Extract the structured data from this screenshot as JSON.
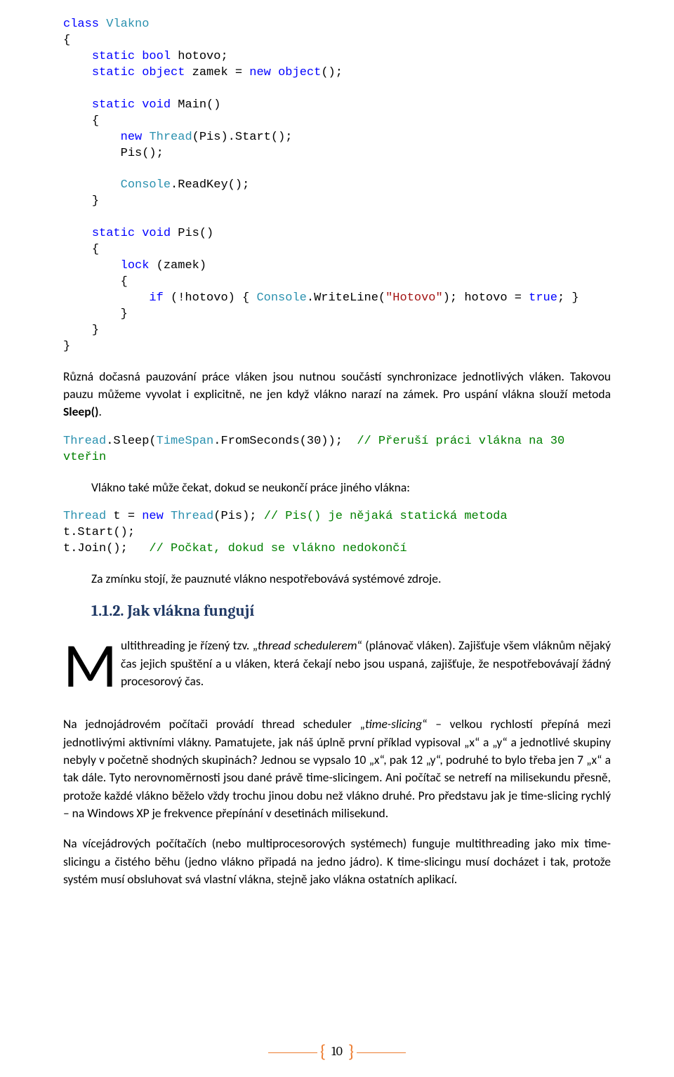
{
  "code1": {
    "kw_class": "class",
    "cls_Vlakno": "Vlakno",
    "lb1": "{",
    "indent": "    ",
    "kw_static": "static",
    "kw_bool": "bool",
    "id_hotovo": "hotovo;",
    "kw_object": "object",
    "id_zamek": "zamek = ",
    "kw_new": "new",
    "obj_ctor": "object",
    "obj_end": "();",
    "kw_void": "void",
    "id_main": "Main()",
    "lb2": "{",
    "newthread_new": "new",
    "newthread_cls": "Thread",
    "newthread_rest": "(Pis).Start();",
    "pis_call": "Pis();",
    "console_cls": "Console",
    "readkey": ".ReadKey();",
    "rb1": "}",
    "id_pis": "Pis()",
    "kw_lock": "lock",
    "lock_arg": " (zamek)",
    "kw_if": "if",
    "if_cond": " (!hotovo) { ",
    "writeln": ".WriteLine(",
    "str_hotovo": "\"Hotovo\"",
    "after_str": "); hotovo = ",
    "kw_true": "true",
    "after_true": "; }",
    "rb2": "}",
    "rb3": "}",
    "rb4": "}"
  },
  "para1_a": "Různá dočasná pauzování práce vláken jsou nutnou součástí synchronizace jednotlivých vláken. Takovou pauzu můžeme vyvolat i explicitně, ne jen když vlákno narazí na zámek. Pro uspání vlákna slouží metoda ",
  "para1_b": "Sleep()",
  "para1_c": ".",
  "code2": {
    "thread_cls": "Thread",
    "sleep": ".Sleep(",
    "timespan_cls": "TimeSpan",
    "fromsec": ".FromSeconds(30));",
    "com": "// Přeruší práci vlákna na 30",
    "line2": "vteřin"
  },
  "para2": "Vlákno také může čekat, dokud se neukončí práce jiného vlákna:",
  "code3": {
    "thread_cls": "Thread",
    "tdecl": " t = ",
    "kw_new": "new",
    "ctor": "Thread",
    "ctor_rest": "(Pis); ",
    "com1": "// Pis() je nějaká statická metoda",
    "l2": "t.Start();",
    "l3": "t.Join();   ",
    "com2": "// Počkat, dokud se vlákno nedokončí"
  },
  "para3": "Za zmínku stojí, že pauznuté vlákno nespotřebovává systémové zdroje.",
  "heading": "1.1.2. Jak vlákna fungují",
  "cap": "M",
  "capPara_a": "ultithreading je řízený tzv. „",
  "capPara_i": "thread schedulerem",
  "capPara_b": "“ (plánovač vláken). Zajišťuje všem vláknům nějaký čas jejich spuštění a u vláken, která čekají nebo jsou uspaná, zajišťuje, že nespotřebovávají žádný procesorový čas.",
  "para4_a": "Na jednojádrovém počítači provádí thread scheduler „",
  "para4_i": "time-slicing",
  "para4_b": "“ – velkou rychlostí přepíná mezi jednotlivými aktivními vlákny. Pamatujete, jak náš úplně první příklad vypisoval „x“ a „y“ a jednotlivé skupiny nebyly v početně shodných skupinách? Jednou se vypsalo 10 „x“, pak 12 „y“, podruhé to bylo třeba jen 7 „x“ a tak dále. Tyto nerovnoměrnosti jsou dané právě time-slicingem. Ani počítač se netrefí na milisekundu přesně, protože každé vlákno běželo vždy trochu jinou dobu než vlákno druhé. Pro představu jak je time-slicing rychlý – na Windows XP je frekvence přepínání v desetinách milisekund.",
  "para5": "Na vícejádrových počítačích (nebo multiprocesorových systémech) funguje multithreading jako mix time-slicingu a čistého běhu (jedno vlákno připadá na jedno jádro). K time-slicingu musí docházet i tak, protože systém musí obsluhovat svá vlastní vlákna, stejně jako vlákna ostatních aplikací.",
  "page": "10"
}
